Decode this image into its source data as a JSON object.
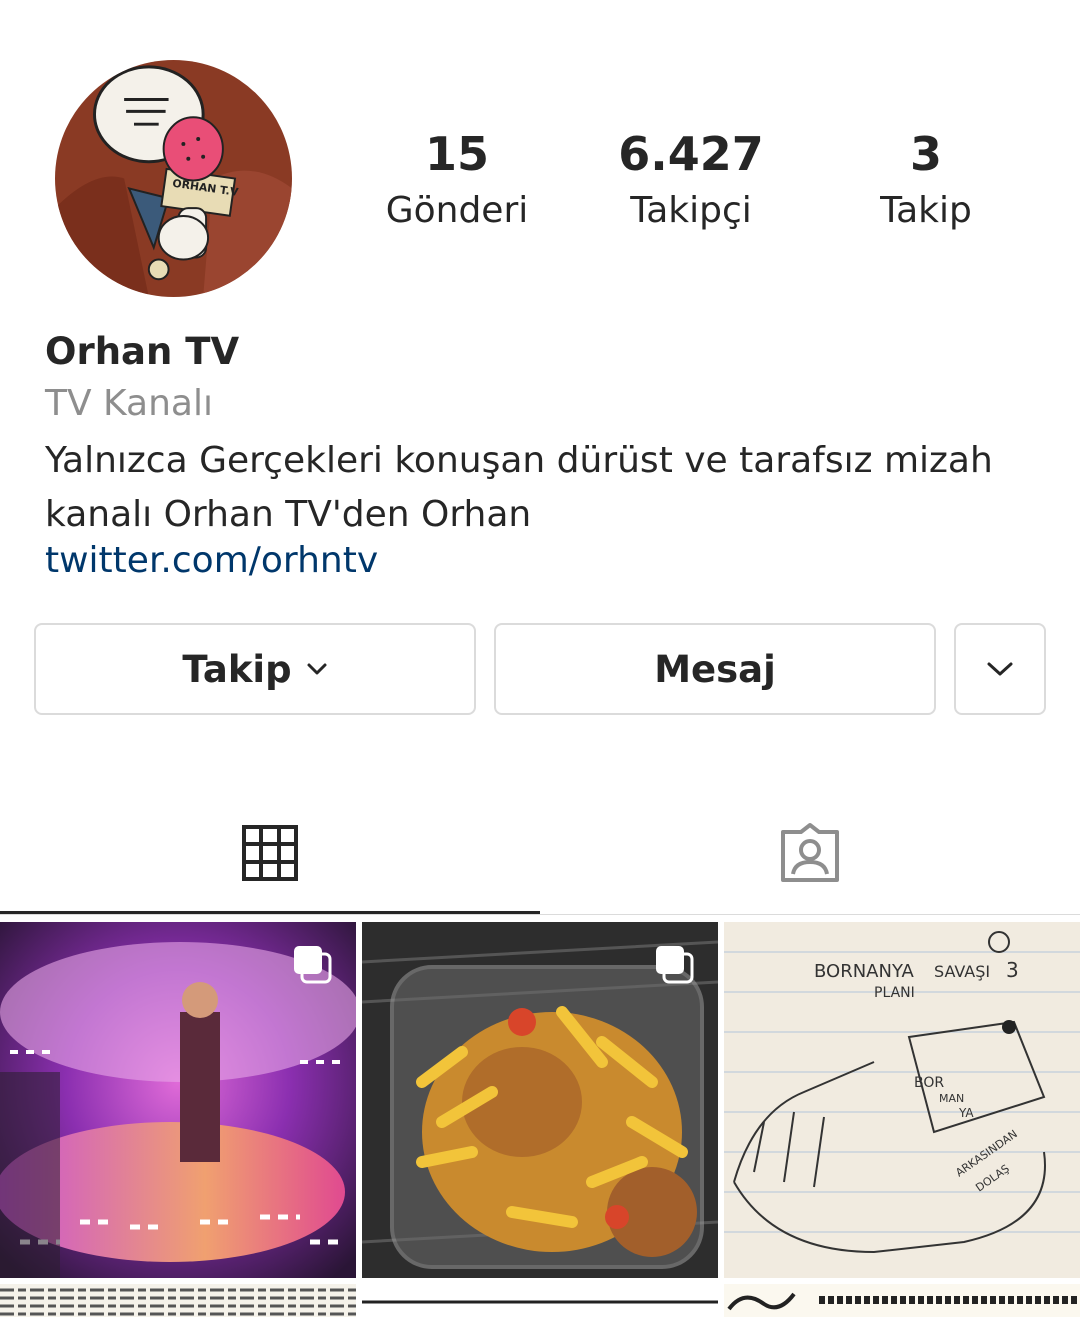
{
  "profile": {
    "name": "Orhan TV",
    "category": "TV Kanalı",
    "bio": "Yalnızca Gerçekleri konuşan dürüst ve tarafsız mizah kanalı Orhan TV'den Orhan",
    "link": "twitter.com/orhntv",
    "avatar_mic_text": "ORHAN T.V"
  },
  "stats": [
    {
      "value": "15",
      "label": "Gönderi"
    },
    {
      "value": "6.427",
      "label": "Takipçi"
    },
    {
      "value": "3",
      "label": "Takip"
    }
  ],
  "actions": {
    "follow_label": "Takip",
    "message_label": "Mesaj"
  },
  "tabs": {
    "active": "grid",
    "items": [
      "grid-icon",
      "tagged-icon"
    ]
  },
  "posts": [
    {
      "description_icon": "multi-photo-icon"
    },
    {
      "description_icon": "multi-photo-icon"
    },
    {
      "note_texts": [
        "BORNANYA",
        "SAVAŞI",
        "3",
        "PLANI",
        "BOR",
        "MAN",
        "YA",
        "ARKASINDAN",
        "DOLAŞ"
      ]
    }
  ],
  "colors": {
    "text": "#262626",
    "secondary": "#8e8e8e",
    "link": "#00376b",
    "border": "#dbdbdb"
  }
}
